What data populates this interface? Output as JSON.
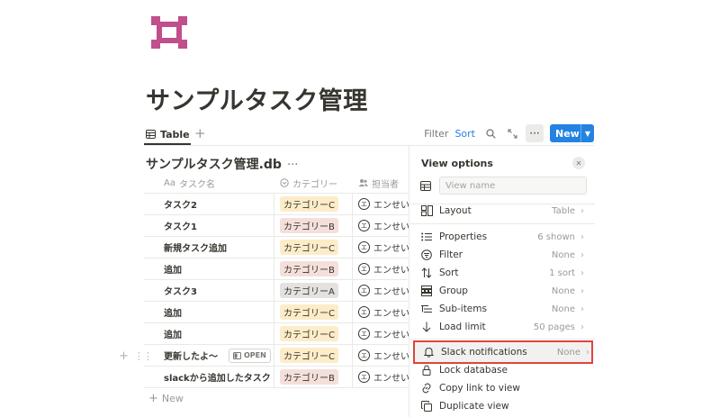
{
  "page": {
    "title": "サンプルタスク管理"
  },
  "view_bar": {
    "tab_label": "Table",
    "add_label": "+",
    "filter_label": "Filter",
    "sort_label": "Sort",
    "new_label": "New"
  },
  "database": {
    "title": "サンプルタスク管理.db",
    "more": "···",
    "columns": {
      "name": "タスク名",
      "name_prefix": "Aa",
      "category": "カテゴリー",
      "assignee": "担当者"
    },
    "rows": [
      {
        "name": "タスク2",
        "category": "カテゴリーC",
        "assignee": "エンせい"
      },
      {
        "name": "タスク1",
        "category": "カテゴリーB",
        "assignee": "エンせい"
      },
      {
        "name": "新規タスク追加",
        "category": "カテゴリーC",
        "assignee": "エンせい"
      },
      {
        "name": "追加",
        "category": "カテゴリーB",
        "assignee": "エンせい"
      },
      {
        "name": "タスク3",
        "category": "カテゴリーA",
        "assignee": "エンせい"
      },
      {
        "name": "追加",
        "category": "カテゴリーC",
        "assignee": "エンせい"
      },
      {
        "name": "追加",
        "category": "カテゴリーC",
        "assignee": "エンせい"
      },
      {
        "name": "更新したよ〜",
        "category": "カテゴリーC",
        "assignee": "エンせい"
      },
      {
        "name": "slackから追加したタスク",
        "category": "カテゴリーB",
        "assignee": "エンせい"
      }
    ],
    "avatar_letter": "エ",
    "open_label": "OPEN",
    "new_row_label": "New"
  },
  "tag_colors": {
    "カテゴリーA": "#e3e2e0",
    "カテゴリーB": "#f4dfdb",
    "カテゴリーC": "#fdecc8"
  },
  "colors": {
    "accent": "#2383e2",
    "page_icon": "#c04f8b",
    "highlight_border": "#e0443e"
  },
  "view_options": {
    "title": "View options",
    "name_placeholder": "View name",
    "close_icon": "close-icon",
    "items": [
      {
        "key": "layout",
        "label": "Layout",
        "value": "Table",
        "icon": "layout-icon"
      },
      {
        "key": "properties",
        "label": "Properties",
        "value": "6 shown",
        "icon": "list-icon"
      },
      {
        "key": "filter",
        "label": "Filter",
        "value": "None",
        "icon": "filter-icon"
      },
      {
        "key": "sort",
        "label": "Sort",
        "value": "1 sort",
        "icon": "sort-icon"
      },
      {
        "key": "group",
        "label": "Group",
        "value": "None",
        "icon": "group-icon"
      },
      {
        "key": "subitems",
        "label": "Sub-items",
        "value": "None",
        "icon": "subitems-icon"
      },
      {
        "key": "loadlimit",
        "label": "Load limit",
        "value": "50 pages",
        "icon": "arrow-down-icon"
      },
      {
        "key": "slack",
        "label": "Slack notifications",
        "value": "None",
        "icon": "bell-icon"
      },
      {
        "key": "lock",
        "label": "Lock database",
        "value": "",
        "icon": "lock-icon"
      },
      {
        "key": "copylink",
        "label": "Copy link to view",
        "value": "",
        "icon": "link-icon"
      },
      {
        "key": "duplicate",
        "label": "Duplicate view",
        "value": "",
        "icon": "duplicate-icon"
      }
    ]
  }
}
